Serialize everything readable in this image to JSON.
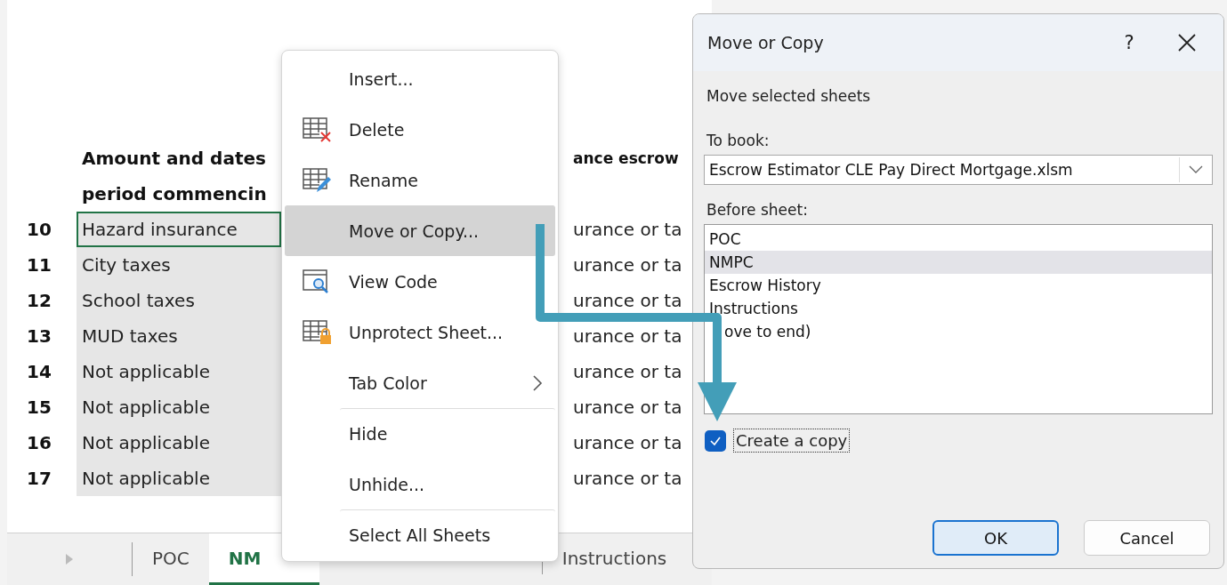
{
  "sheet": {
    "header_lines": [
      {
        "left": "Amount and dates",
        "right": "ance escrow"
      },
      {
        "left": "period commencin"
      }
    ],
    "rows": [
      {
        "number": "10",
        "item": "Hazard insurance",
        "column_3": "urance or ta",
        "active": true
      },
      {
        "number": "11",
        "item": "City taxes",
        "column_3": "urance or ta",
        "active": false
      },
      {
        "number": "12",
        "item": "School taxes",
        "column_3": "urance or ta",
        "active": false
      },
      {
        "number": "13",
        "item": "MUD taxes",
        "column_3": "urance or ta",
        "active": false
      },
      {
        "number": "14",
        "item": "Not applicable",
        "column_3": "urance or ta",
        "active": false
      },
      {
        "number": "15",
        "item": "Not applicable",
        "column_3": "urance or ta",
        "active": false
      },
      {
        "number": "16",
        "item": "Not applicable",
        "column_3": "urance or ta",
        "active": false
      },
      {
        "number": "17",
        "item": "Not applicable",
        "column_3": "urance or ta",
        "active": false
      }
    ]
  },
  "sheet_tabs": [
    {
      "label": "POC",
      "selected": false
    },
    {
      "label": "NM",
      "selected": true
    },
    {
      "label": "Instructions",
      "selected": false
    }
  ],
  "context_menu": {
    "items": [
      {
        "label": "Insert...",
        "highlighted": false,
        "separator_before": false,
        "submenu": false
      },
      {
        "label": "Delete",
        "highlighted": false,
        "separator_before": false,
        "submenu": false
      },
      {
        "label": "Rename",
        "highlighted": false,
        "separator_before": false,
        "submenu": false
      },
      {
        "label": "Move or Copy...",
        "highlighted": true,
        "separator_before": false,
        "submenu": false
      },
      {
        "label": "View Code",
        "highlighted": false,
        "separator_before": false,
        "submenu": false
      },
      {
        "label": "Unprotect Sheet...",
        "highlighted": false,
        "separator_before": false,
        "submenu": false
      },
      {
        "label": "Tab Color",
        "highlighted": false,
        "separator_before": false,
        "submenu": true
      },
      {
        "label": "Hide",
        "highlighted": false,
        "separator_before": true,
        "submenu": false
      },
      {
        "label": "Unhide...",
        "highlighted": false,
        "separator_before": false,
        "submenu": false
      },
      {
        "label": "Select All Sheets",
        "highlighted": false,
        "separator_before": true,
        "submenu": false
      }
    ]
  },
  "dialog": {
    "title": "Move or Copy",
    "help": "?",
    "message": "Move selected sheets",
    "to_book_label": "To book:",
    "to_book_value": "Escrow Estimator CLE Pay Direct Mortgage.xlsm",
    "before_sheet_label": "Before sheet:",
    "sheets": [
      {
        "label": "POC",
        "selected": false
      },
      {
        "label": "NMPC",
        "selected": true
      },
      {
        "label": "Escrow History",
        "selected": false
      },
      {
        "label": "Instructions",
        "selected": false
      },
      {
        "label": "ove to end)",
        "selected": false
      }
    ],
    "create_copy": {
      "label": "Create a copy",
      "checked": true
    },
    "buttons": [
      {
        "label": "OK",
        "default": true
      },
      {
        "label": "Cancel",
        "default": false
      }
    ]
  }
}
